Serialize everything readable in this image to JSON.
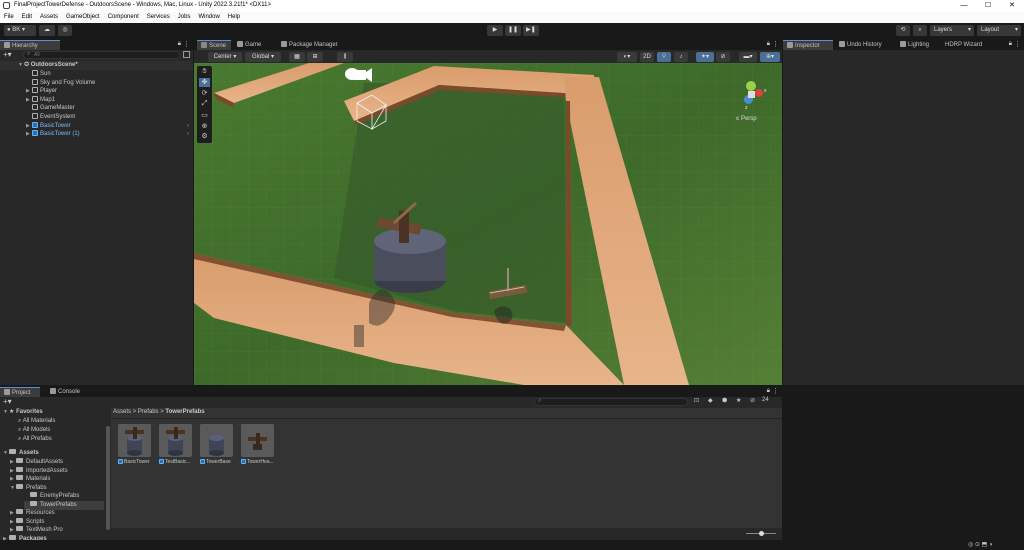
{
  "window": {
    "title": "FinalProjectTowerDefense - OutdoorsScene - Windows, Mac, Linux - Unity 2022.3.21f1* <DX11>",
    "min": "—",
    "max": "☐",
    "close": "✕"
  },
  "menu": [
    "File",
    "Edit",
    "Assets",
    "GameObject",
    "Component",
    "Services",
    "Jobs",
    "Window",
    "Help"
  ],
  "toolbar": {
    "account": "BK",
    "layers": "Layers",
    "layout": "Layout"
  },
  "hierarchy": {
    "tab": "Hierarchy",
    "search_placeholder": "All",
    "scene": "OutdoorsScene*",
    "items": [
      {
        "label": "Sun",
        "prefab": false,
        "expandable": false
      },
      {
        "label": "Sky and Fog Volume",
        "prefab": false,
        "expandable": false
      },
      {
        "label": "Player",
        "prefab": false,
        "expandable": true
      },
      {
        "label": "Map1",
        "prefab": false,
        "expandable": true
      },
      {
        "label": "GameMaster",
        "prefab": false,
        "expandable": false
      },
      {
        "label": "EventSystem",
        "prefab": false,
        "expandable": false
      },
      {
        "label": "BasicTower",
        "prefab": true,
        "expandable": true
      },
      {
        "label": "BasicTower (1)",
        "prefab": true,
        "expandable": true
      }
    ]
  },
  "scene_tabs": {
    "scene": "Scene",
    "game": "Game",
    "package": "Package Manager"
  },
  "scene_toolbar": {
    "pivot": "Center",
    "space": "Global",
    "mode2d": "2D"
  },
  "scene_gizmo": {
    "persp": "Persp",
    "x": "x",
    "z": "z"
  },
  "inspector_tabs": {
    "inspector": "Inspector",
    "undo": "Undo History",
    "lighting": "Lighting",
    "hdrp": "HDRP Wizard"
  },
  "project": {
    "tab_project": "Project",
    "tab_console": "Console",
    "favorites": "Favorites",
    "favorite_items": [
      "All Materials",
      "All Models",
      "All Prefabs"
    ],
    "assets_root": "Assets",
    "folders": [
      {
        "label": "DefaultAssets",
        "depth": 1
      },
      {
        "label": "ImportedAssets",
        "depth": 1
      },
      {
        "label": "Materials",
        "depth": 1
      },
      {
        "label": "Prefabs",
        "depth": 1
      },
      {
        "label": "EnemyPrefabs",
        "depth": 2
      },
      {
        "label": "TowerPrefabs",
        "depth": 2
      },
      {
        "label": "Resources",
        "depth": 1
      },
      {
        "label": "Scripts",
        "depth": 1
      },
      {
        "label": "TextMesh Pro",
        "depth": 1
      },
      {
        "label": "Packages",
        "depth": 0
      }
    ],
    "breadcrumb": [
      "Assets",
      "Prefabs",
      "TowerPrefabs"
    ],
    "asset_count": "24",
    "assets": [
      "BasicTower",
      "TestBasic...",
      "TowerBase",
      "TowerHea..."
    ]
  },
  "colors": {
    "accent": "#5a8fd8",
    "prefab": "#7cbcf5",
    "grass": "#3f6b2a",
    "path": "#e0a87a",
    "selection": "#2c5d87"
  }
}
